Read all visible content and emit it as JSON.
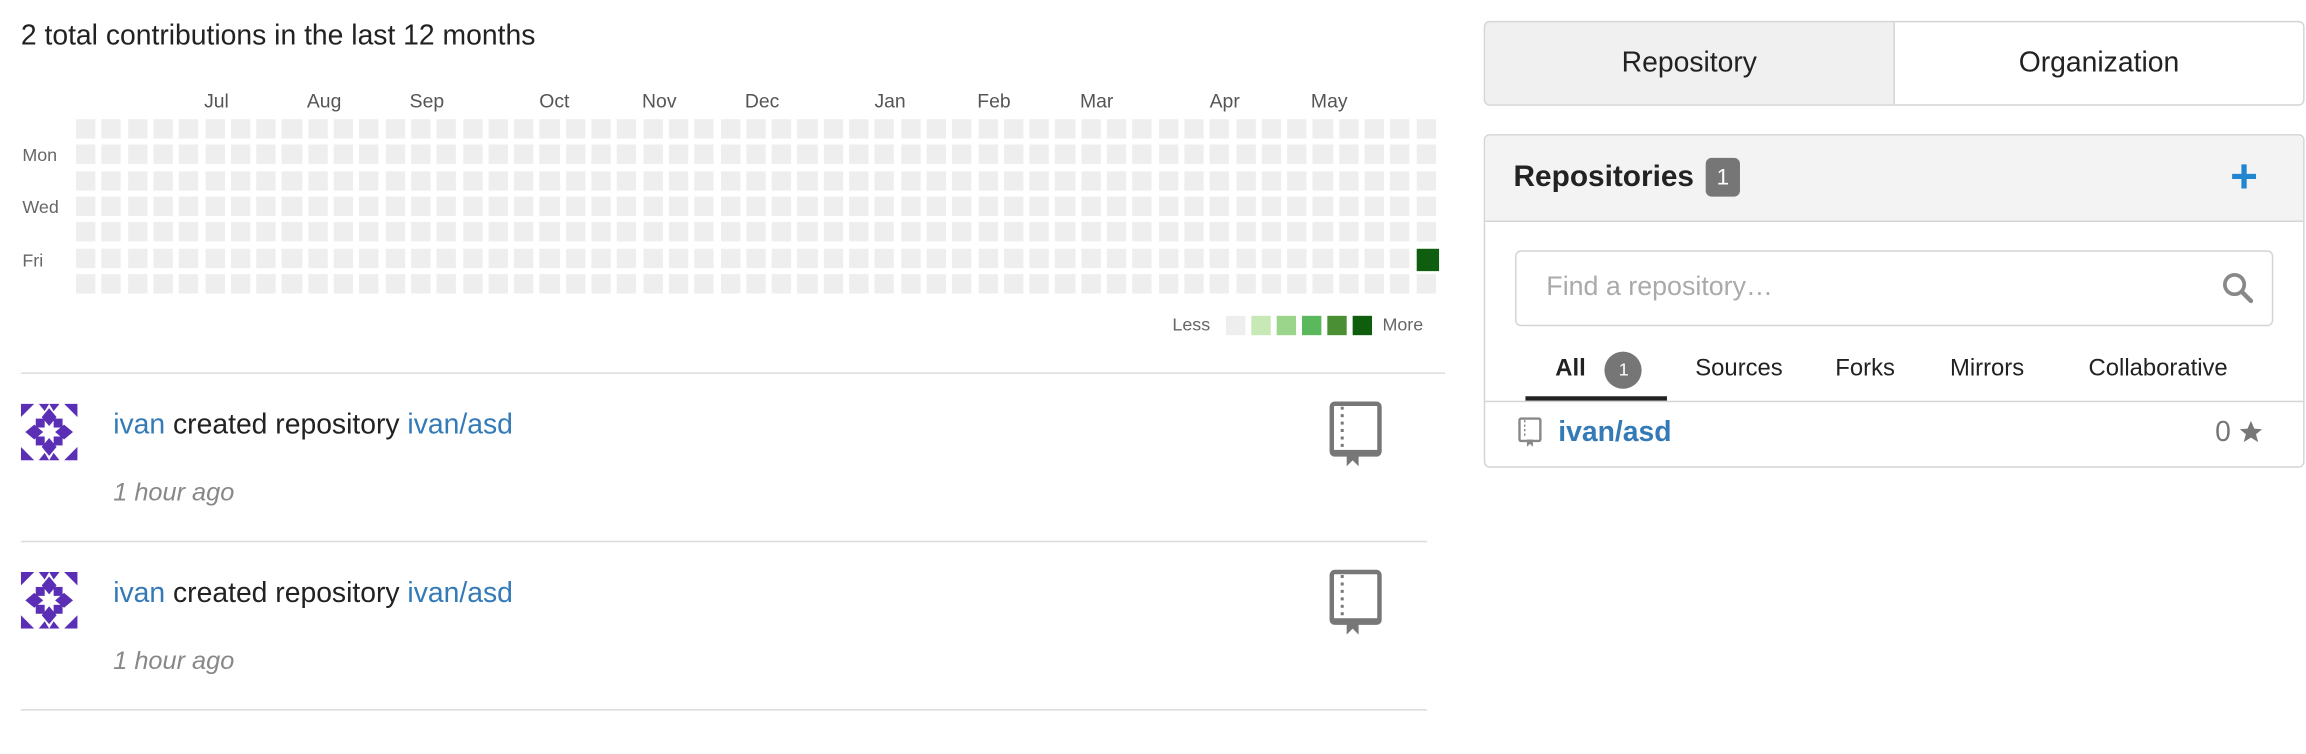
{
  "contributions": {
    "title": "2 total contributions in the last 12 months",
    "months": [
      "Jul",
      "Aug",
      "Sep",
      "Oct",
      "Nov",
      "Dec",
      "Jan",
      "Feb",
      "Mar",
      "Apr",
      "May"
    ],
    "days": [
      "Mon",
      "Wed",
      "Fri"
    ],
    "legend": {
      "less": "Less",
      "more": "More"
    },
    "colors": [
      "#eeeeee",
      "#d6e685",
      "#8cc665",
      "#44a340",
      "#1e6823"
    ],
    "legend_colors": [
      "#eeeeee",
      "#c6e9b5",
      "#9bd48b",
      "#5cb85c",
      "#4a8f34",
      "#0e5e0e"
    ],
    "active_color": "#0f5e0f"
  },
  "feed": [
    {
      "user": "ivan",
      "action": "created repository",
      "repo": "ivan/asd",
      "time": "1 hour ago"
    },
    {
      "user": "ivan",
      "action": "created repository",
      "repo": "ivan/asd",
      "time": "1 hour ago"
    }
  ],
  "switch": {
    "repository": "Repository",
    "organization": "Organization"
  },
  "repos": {
    "title": "Repositories",
    "count": "1",
    "add_icon": "plus-icon",
    "search_placeholder": "Find a repository…",
    "tabs": [
      {
        "label": "All",
        "badge": "1"
      },
      {
        "label": "Sources"
      },
      {
        "label": "Forks"
      },
      {
        "label": "Mirrors"
      },
      {
        "label": "Collaborative"
      }
    ],
    "items": [
      {
        "name": "ivan/asd",
        "stars": "0"
      }
    ]
  }
}
